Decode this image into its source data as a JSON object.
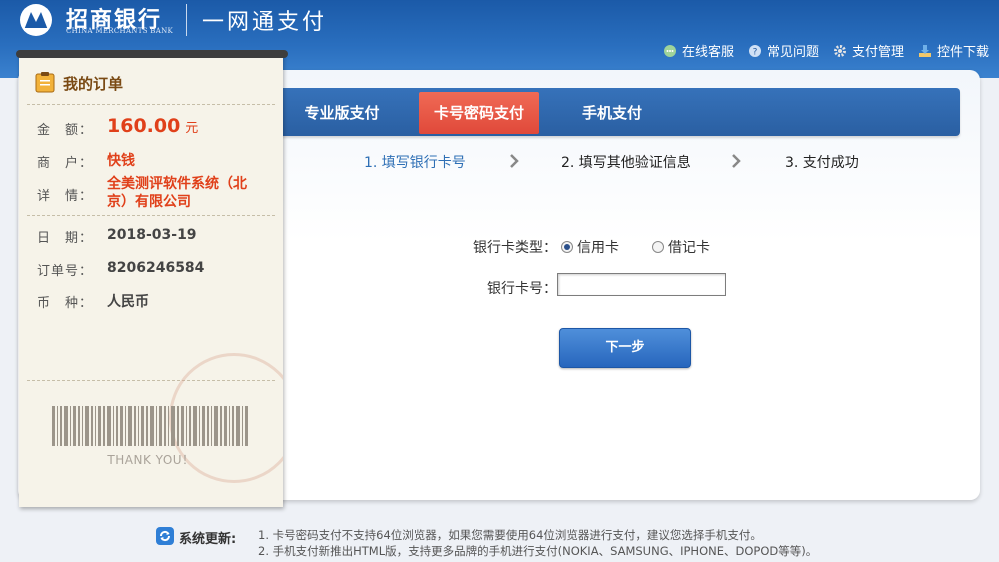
{
  "header": {
    "brand_cn": "招商银行",
    "brand_en": "CHINA MERCHANTS BANK",
    "product": "一网通支付",
    "links": [
      {
        "label": "在线客服",
        "icon": "chat-icon"
      },
      {
        "label": "常见问题",
        "icon": "help-icon"
      },
      {
        "label": "支付管理",
        "icon": "gear-icon"
      },
      {
        "label": "控件下载",
        "icon": "download-icon"
      }
    ]
  },
  "order": {
    "title": "我的订单",
    "amount_label": "金　额：",
    "amount": "160.00",
    "amount_unit": "元",
    "merchant_label": "商　户：",
    "merchant": "快钱",
    "detail_label": "详　情：",
    "detail_line1": "全美测评软件系统（北",
    "detail_line2": "京）有限公司",
    "date_label": "日　期：",
    "date": "2018-03-19",
    "order_no_label": "订单号：",
    "order_no": "8206246584",
    "currency_label": "币　种：",
    "currency": "人民币",
    "thanks": "THANK YOU！"
  },
  "tabs": [
    {
      "label": "专业版支付",
      "active": false
    },
    {
      "label": "卡号密码支付",
      "active": true
    },
    {
      "label": "手机支付",
      "active": false
    }
  ],
  "steps": [
    {
      "label": "1. 填写银行卡号",
      "current": true
    },
    {
      "label": "2. 填写其他验证信息",
      "current": false
    },
    {
      "label": "3. 支付成功",
      "current": false
    }
  ],
  "form": {
    "card_type_label": "银行卡类型：",
    "card_type_options": [
      {
        "label": "信用卡",
        "checked": true
      },
      {
        "label": "借记卡",
        "checked": false
      }
    ],
    "card_number_label": "银行卡号：",
    "card_number_value": "",
    "next_button": "下一步"
  },
  "footer": {
    "title": "系统更新:",
    "lines": [
      "1. 卡号密码支付不支持64位浏览器，如果您需要使用64位浏览器进行支付，建议您选择手机支付。",
      "2. 手机支付新推出HTML版，支持更多品牌的手机进行支付(NOKIA、SAMSUNG、IPHONE、DOPOD等等)。"
    ]
  },
  "colors": {
    "header_blue": "#2a6fbf",
    "tab_active": "#e0493a",
    "amount_red": "#e0401a",
    "step_current": "#2e6fb5"
  }
}
